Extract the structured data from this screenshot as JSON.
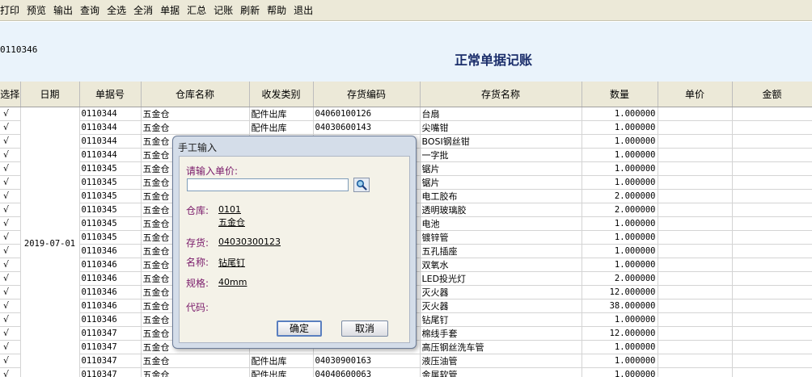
{
  "menu": [
    "打印",
    "预览",
    "输出",
    "查询",
    "全选",
    "全消",
    "单据",
    "汇总",
    "记账",
    "刷新",
    "帮助",
    "退出"
  ],
  "header": {
    "doc_no": "0110346",
    "title": "正常单据记账"
  },
  "table": {
    "columns": [
      "选择",
      "日期",
      "单据号",
      "仓库名称",
      "收发类别",
      "存货编码",
      "存货名称",
      "数量",
      "单价",
      "金额"
    ],
    "date_merged": "2019-07-01",
    "rows": [
      {
        "sel": "√",
        "no": "0110344",
        "wh": "五金仓",
        "type": "配件出库",
        "code": "04060100126",
        "name": "台扇",
        "qty": "1.000000"
      },
      {
        "sel": "√",
        "no": "0110344",
        "wh": "五金仓",
        "type": "配件出库",
        "code": "04030600143",
        "name": "尖嘴钳",
        "qty": "1.000000"
      },
      {
        "sel": "√",
        "no": "0110344",
        "wh": "五金仓",
        "type": "",
        "code": "",
        "name": "BOSI钢丝钳",
        "qty": "1.000000"
      },
      {
        "sel": "√",
        "no": "0110344",
        "wh": "五金仓",
        "type": "",
        "code": "",
        "name": "一字批",
        "qty": "1.000000"
      },
      {
        "sel": "√",
        "no": "0110345",
        "wh": "五金仓",
        "type": "",
        "code": "",
        "name": "锯片",
        "qty": "1.000000"
      },
      {
        "sel": "√",
        "no": "0110345",
        "wh": "五金仓",
        "type": "",
        "code": "",
        "name": "锯片",
        "qty": "1.000000"
      },
      {
        "sel": "√",
        "no": "0110345",
        "wh": "五金仓",
        "type": "",
        "code": "",
        "name": "电工胶布",
        "qty": "2.000000"
      },
      {
        "sel": "√",
        "no": "0110345",
        "wh": "五金仓",
        "type": "",
        "code": "",
        "name": "透明玻璃胶",
        "qty": "2.000000"
      },
      {
        "sel": "√",
        "no": "0110345",
        "wh": "五金仓",
        "type": "",
        "code": "",
        "name": "电池",
        "qty": "1.000000"
      },
      {
        "sel": "√",
        "no": "0110345",
        "wh": "五金仓",
        "type": "",
        "code": "",
        "name": "镀锌管",
        "qty": "1.000000"
      },
      {
        "sel": "√",
        "no": "0110346",
        "wh": "五金仓",
        "type": "",
        "code": "",
        "name": "五孔插座",
        "qty": "1.000000"
      },
      {
        "sel": "√",
        "no": "0110346",
        "wh": "五金仓",
        "type": "",
        "code": "",
        "name": "双氧水",
        "qty": "1.000000"
      },
      {
        "sel": "√",
        "no": "0110346",
        "wh": "五金仓",
        "type": "",
        "code": "",
        "name": "LED投光灯",
        "qty": "2.000000"
      },
      {
        "sel": "√",
        "no": "0110346",
        "wh": "五金仓",
        "type": "",
        "code": "",
        "name": "灭火器",
        "qty": "12.000000"
      },
      {
        "sel": "√",
        "no": "0110346",
        "wh": "五金仓",
        "type": "",
        "code": "",
        "name": "灭火器",
        "qty": "38.000000"
      },
      {
        "sel": "√",
        "no": "0110346",
        "wh": "五金仓",
        "type": "",
        "code": "",
        "name": "钻尾钉",
        "qty": "1.000000"
      },
      {
        "sel": "√",
        "no": "0110347",
        "wh": "五金仓",
        "type": "",
        "code": "",
        "name": "棉线手套",
        "qty": "12.000000"
      },
      {
        "sel": "√",
        "no": "0110347",
        "wh": "五金仓",
        "type": "",
        "code": "",
        "name": "高压钢丝洗车管",
        "qty": "1.000000"
      },
      {
        "sel": "√",
        "no": "0110347",
        "wh": "五金仓",
        "type": "配件出库",
        "code": "04030900163",
        "name": "液压油管",
        "qty": "1.000000"
      },
      {
        "sel": "√",
        "no": "0110347",
        "wh": "五金仓",
        "type": "配件出库",
        "code": "04040600063",
        "name": "金属软管",
        "qty": "1.000000"
      }
    ]
  },
  "dialog": {
    "title": "手工输入",
    "prompt": "请输入单价:",
    "input_value": "",
    "warehouse_label": "仓库:",
    "warehouse_code": "0101",
    "warehouse_name": "五金仓",
    "stock_label": "存货:",
    "stock_code": "04030300123",
    "name_label": "名称:",
    "name_value": "钻尾钉",
    "spec_label": "规格:",
    "spec_value": "40mm",
    "code_label": "代码:",
    "code_value": "",
    "ok_label": "确定",
    "cancel_label": "取消"
  }
}
